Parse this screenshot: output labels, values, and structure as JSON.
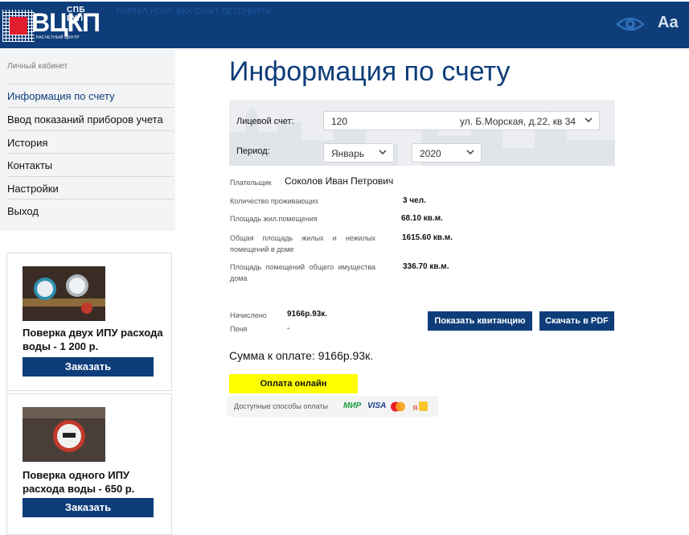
{
  "header": {
    "logo_top": "СПБ ГУП",
    "logo_main": "ВЦКП",
    "logo_sub": "РАСЧЕТНЫЙ ЦЕНТР",
    "portal_text": "ПОРТАЛ УСЛУГ ЖКХ САНКТ-ПЕТЕРБУРГА",
    "font_size_label": "Aa",
    "brand_color": "#0e3d7a",
    "accent_red": "#e11d2e",
    "vision_icon": "eye-icon"
  },
  "sidebar": {
    "caption": "Личный кабинет",
    "items": [
      {
        "label": "Информация по счету",
        "active": true
      },
      {
        "label": "Ввод показаний приборов учета",
        "active": false
      },
      {
        "label": "История",
        "active": false
      },
      {
        "label": "Контакты",
        "active": false
      },
      {
        "label": "Настройки",
        "active": false
      },
      {
        "label": "Выход",
        "active": false
      }
    ]
  },
  "promos": [
    {
      "title": "Поверка двух ИПУ расхода воды - 1 200 р.",
      "button": "Заказать"
    },
    {
      "title": "Поверка одного ИПУ расхода воды - 650 р.",
      "button": "Заказать"
    }
  ],
  "main": {
    "title": "Информация по счету",
    "account_label": "Лицевой счет:",
    "account_number": "120",
    "account_address": "ул. Б.Морская, д.22, кв 34",
    "period_label": "Период:",
    "period_month": "Январь",
    "period_year": "2020",
    "payer_label": "Плательщик",
    "payer_name": "Соколов Иван Петрович",
    "residents_label": "Количество проживающих",
    "residents_value": "3 чел.",
    "living_area_label": "Площадь жил.помещения",
    "living_area_value": "68.10 кв.м.",
    "total_area_label": "Общая площадь жилых и нежилых помещений в доме",
    "total_area_value": "1615.60 кв.м.",
    "common_area_label": "Площадь помещений общего имущества дома",
    "common_area_value": "336.70 кв.м.",
    "charged_label": "Начислено",
    "charged_value": "9166р.93к.",
    "penalty_label": "Пеня",
    "penalty_value": "-",
    "show_receipt": "Показать квитанцию",
    "download_pdf": "Скачать в PDF",
    "total_due": "Сумма к оплате: 9166р.93к.",
    "pay_online": "Оплата онлайн",
    "pay_methods_label": "Доступные способы оплаты",
    "pay_methods": [
      "МИР",
      "VISA",
      "Mastercard",
      "Яндекс"
    ]
  }
}
